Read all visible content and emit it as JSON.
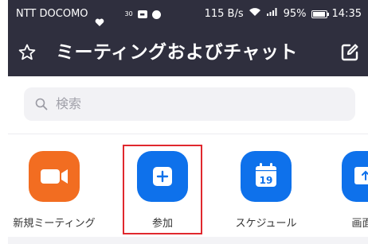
{
  "status_bar": {
    "carrier": "NTT DOCOMO",
    "signal_small": "30",
    "speed": "115 B/s",
    "battery": "95%",
    "battery_level": 0.95,
    "time": "14:35"
  },
  "header": {
    "title": "ミーティングおよびチャット",
    "star_icon": "star-icon",
    "edit_icon": "edit-icon"
  },
  "search": {
    "placeholder": "検索",
    "icon": "search-icon"
  },
  "actions": [
    {
      "label": "新規ミーティング",
      "icon": "video-camera-icon",
      "color": "#f26d21"
    },
    {
      "label": "参加",
      "icon": "plus-icon",
      "color": "#0e71eb"
    },
    {
      "label": "スケジュール",
      "icon": "calendar-icon",
      "color": "#0e71eb",
      "icon_text": "19"
    },
    {
      "label": "画面の",
      "icon": "share-screen-icon",
      "color": "#0e71eb"
    }
  ],
  "colors": {
    "header_bg": "#2f2f3e",
    "highlight": "#e0282e",
    "orange": "#f26d21",
    "blue": "#0e71eb"
  }
}
